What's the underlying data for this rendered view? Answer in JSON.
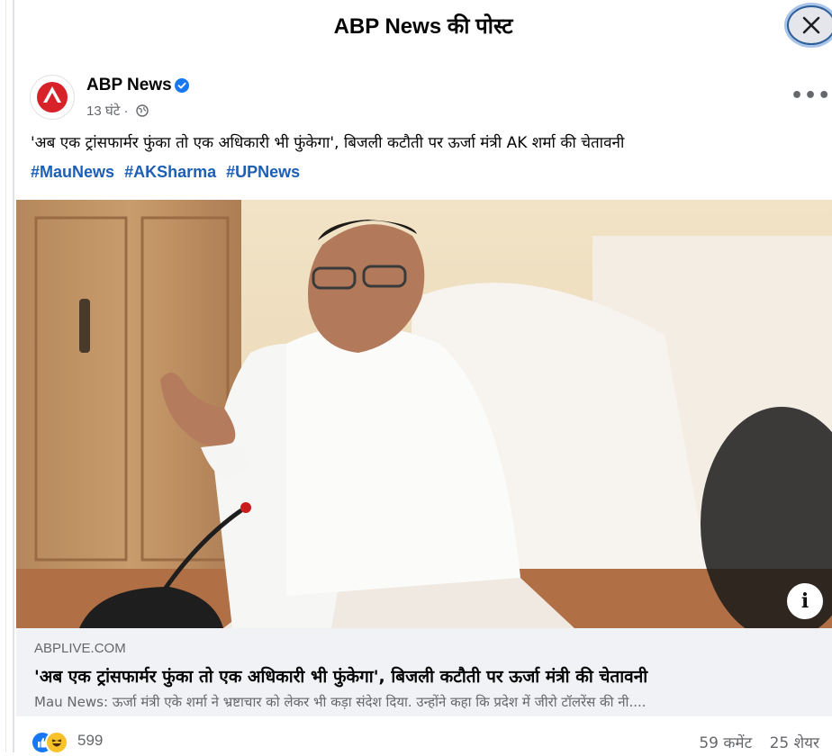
{
  "modal": {
    "title": "ABP News की पोस्ट"
  },
  "post": {
    "author": "ABP News",
    "time": "13 घंटे",
    "separator": "·",
    "text": "'अब एक ट्रांसफार्मर फुंका तो एक अधिकारी भी फुंकेगा', बिजली कटौती पर ऊर्जा मंत्री AK शर्मा की चेतावनी",
    "hashtags": [
      "#MauNews",
      "#AKSharma",
      "#UPNews"
    ],
    "more_label": "•••"
  },
  "link_preview": {
    "domain": "ABPLIVE.COM",
    "title": "'अब एक ट्रांसफार्मर फुंका तो एक अधिकारी भी फुंकेगा', बिजली कटौती पर ऊर्जा मंत्री की चेतावनी",
    "description": "Mau News: ऊर्जा मंत्री एके शर्मा ने भ्रष्टाचार को लेकर भी कड़ा संदेश दिया. उन्होंने कहा कि प्रदेश में जीरो टॉलरेंस की नी....",
    "info_label": "i"
  },
  "stats": {
    "reactions_count": "599",
    "comments": "59 कमेंट",
    "shares": "25 शेयर"
  },
  "colors": {
    "link_blue": "#1d5fb5",
    "verified_blue": "#1877f2",
    "brand_red": "#d8222a"
  },
  "icons": [
    "close-icon",
    "verified-badge-icon",
    "globe-icon",
    "more-options-icon",
    "info-icon",
    "like-reaction-icon",
    "haha-reaction-icon"
  ]
}
